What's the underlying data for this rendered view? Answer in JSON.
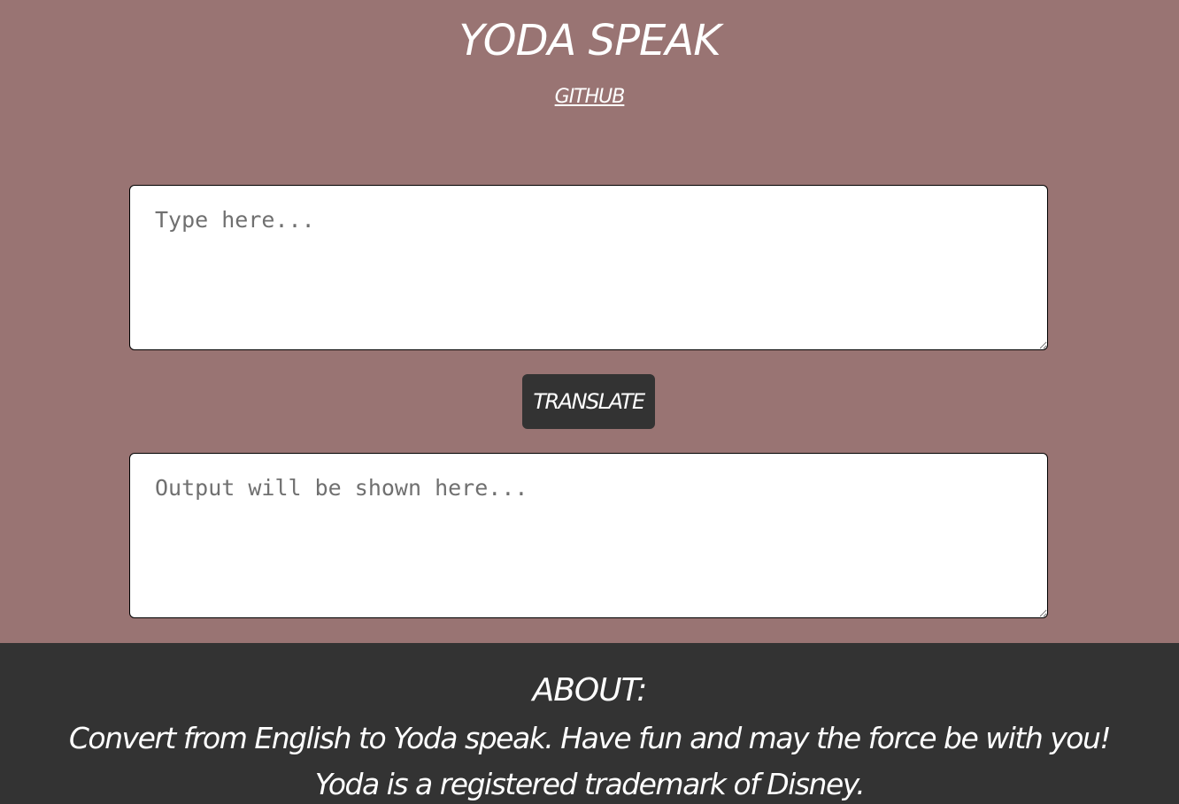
{
  "header": {
    "title": "YODA SPEAK",
    "github_label": "GITHUB"
  },
  "input": {
    "placeholder": "Type here...",
    "value": ""
  },
  "translate_button": {
    "label": "TRANSLATE"
  },
  "output": {
    "placeholder": "Output will be shown here...",
    "value": ""
  },
  "footer": {
    "heading": "ABOUT:",
    "text": "Convert from English to Yoda speak. Have fun and may the force be with you! Yoda is a registered trademark of Disney."
  },
  "colors": {
    "page_background": "#997473",
    "footer_background": "#333333",
    "button_background": "#333333",
    "text": "#ffffff"
  }
}
